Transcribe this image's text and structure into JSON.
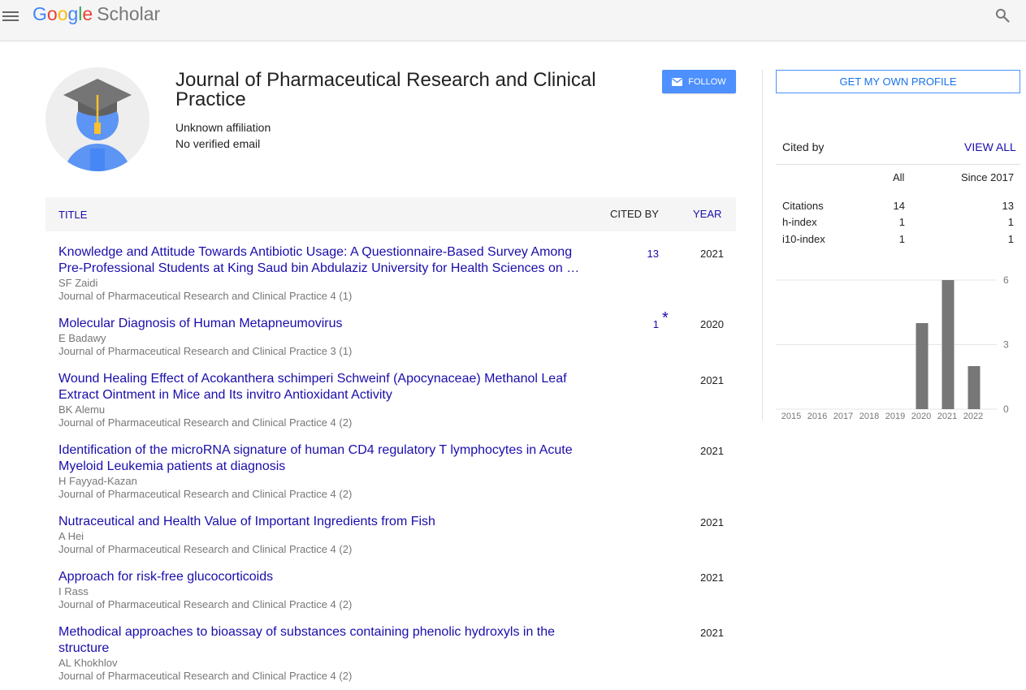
{
  "header": {
    "logo_letters": [
      "G",
      "o",
      "o",
      "g",
      "l",
      "e"
    ],
    "logo_product": "Scholar",
    "icons": {
      "menu": "menu-icon",
      "search": "search-icon"
    }
  },
  "profile": {
    "name": "Journal of Pharmaceutical Research and Clinical Practice",
    "affiliation": "Unknown affiliation",
    "email": "No verified email",
    "follow_label": "FOLLOW"
  },
  "table": {
    "col_title": "TITLE",
    "col_cited": "CITED BY",
    "col_year": "YEAR"
  },
  "articles": [
    {
      "title": "Knowledge and Attitude Towards Antibiotic Usage: A Questionnaire-Based Survey Among Pre-Professional Students at King Saud bin Abdulaziz University for Health Sciences on …",
      "authors": "SF Zaidi",
      "venue": "Journal of Pharmaceutical Research and Clinical Practice 4 (1)",
      "cited": "13",
      "star": "",
      "year": "2021"
    },
    {
      "title": "Molecular Diagnosis of Human Metapneumovirus",
      "authors": "E Badawy",
      "venue": "Journal of Pharmaceutical Research and Clinical Practice 3 (1)",
      "cited": "1",
      "star": "*",
      "year": "2020"
    },
    {
      "title": "Wound Healing Effect of Acokanthera schimperi Schweinf (Apocynaceae) Methanol Leaf Extract Ointment in Mice and Its invitro Antioxidant Activity",
      "authors": "BK Alemu",
      "venue": "Journal of Pharmaceutical Research and Clinical Practice 4 (2)",
      "cited": "",
      "star": "",
      "year": "2021"
    },
    {
      "title": "Identification of the microRNA signature of human CD4 regulatory T lymphocytes in Acute Myeloid Leukemia patients at diagnosis",
      "authors": "H Fayyad-Kazan",
      "venue": "Journal of Pharmaceutical Research and Clinical Practice 4 (2)",
      "cited": "",
      "star": "",
      "year": "2021"
    },
    {
      "title": "Nutraceutical and Health Value of Important Ingredients from Fish",
      "authors": "A Hei",
      "venue": "Journal of Pharmaceutical Research and Clinical Practice 4 (2)",
      "cited": "",
      "star": "",
      "year": "2021"
    },
    {
      "title": "Approach for risk-free glucocorticoids",
      "authors": "I Rass",
      "venue": "Journal of Pharmaceutical Research and Clinical Practice 4 (2)",
      "cited": "",
      "star": "",
      "year": "2021"
    },
    {
      "title": "Methodical approaches to bioassay of substances containing phenolic hydroxyls in the structure",
      "authors": "AL Khokhlov",
      "venue": "Journal of Pharmaceutical Research and Clinical Practice 4 (2)",
      "cited": "",
      "star": "",
      "year": "2021"
    }
  ],
  "sidebar": {
    "own_profile_label": "GET MY OWN PROFILE",
    "cited_by_label": "Cited by",
    "view_all_label": "VIEW ALL",
    "col_all": "All",
    "col_since": "Since 2017",
    "stats": [
      {
        "name": "Citations",
        "all": "14",
        "since": "13"
      },
      {
        "name": "h-index",
        "all": "1",
        "since": "1"
      },
      {
        "name": "i10-index",
        "all": "1",
        "since": "1"
      }
    ]
  },
  "chart_data": {
    "type": "bar",
    "categories": [
      "2015",
      "2016",
      "2017",
      "2018",
      "2019",
      "2020",
      "2021",
      "2022"
    ],
    "values": [
      0,
      0,
      0,
      0,
      0,
      4,
      6,
      2
    ],
    "ylim": [
      0,
      6
    ],
    "yticks": [
      0,
      3,
      6
    ],
    "grid": true,
    "y_axis_side": "right",
    "bar_color": "#777777"
  },
  "colors": {
    "link": "#1a0dab",
    "follow_button": "#4d90fe",
    "meta_text": "#777777"
  }
}
